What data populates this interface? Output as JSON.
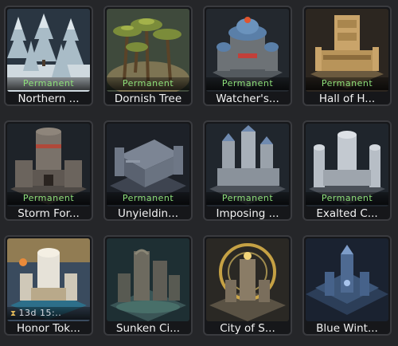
{
  "skins": [
    {
      "name": "Northern ...",
      "status": "Permanent",
      "icon": "snowy-pine-forest-icon"
    },
    {
      "name": "Dornish Tree",
      "status": "Permanent",
      "icon": "palm-grove-icon"
    },
    {
      "name": "Watcher's...",
      "status": "Permanent",
      "icon": "blue-dome-castle-icon"
    },
    {
      "name": "Hall of H...",
      "status": "Permanent",
      "icon": "golden-tower-hall-icon"
    },
    {
      "name": "Storm For...",
      "status": "Permanent",
      "icon": "storm-fortress-icon"
    },
    {
      "name": "Unyieldin...",
      "status": "Permanent",
      "icon": "stone-bastion-icon"
    },
    {
      "name": "Imposing ...",
      "status": "Permanent",
      "icon": "imposing-castle-icon"
    },
    {
      "name": "Exalted C...",
      "status": "Permanent",
      "icon": "exalted-castle-icon"
    },
    {
      "name": "Honor Tok...",
      "status": "13d 15:..",
      "icon": "honor-token-castle-icon"
    },
    {
      "name": "Sunken Ci...",
      "status": "",
      "icon": "sunken-city-icon"
    },
    {
      "name": "City of S...",
      "status": "",
      "icon": "golden-ring-city-icon"
    },
    {
      "name": "Blue Wint...",
      "status": "",
      "icon": "blue-winter-city-icon"
    }
  ],
  "colors": {
    "background": "#252629",
    "permanent_text": "#8ee07a",
    "card_border": "#3a3b3f"
  }
}
